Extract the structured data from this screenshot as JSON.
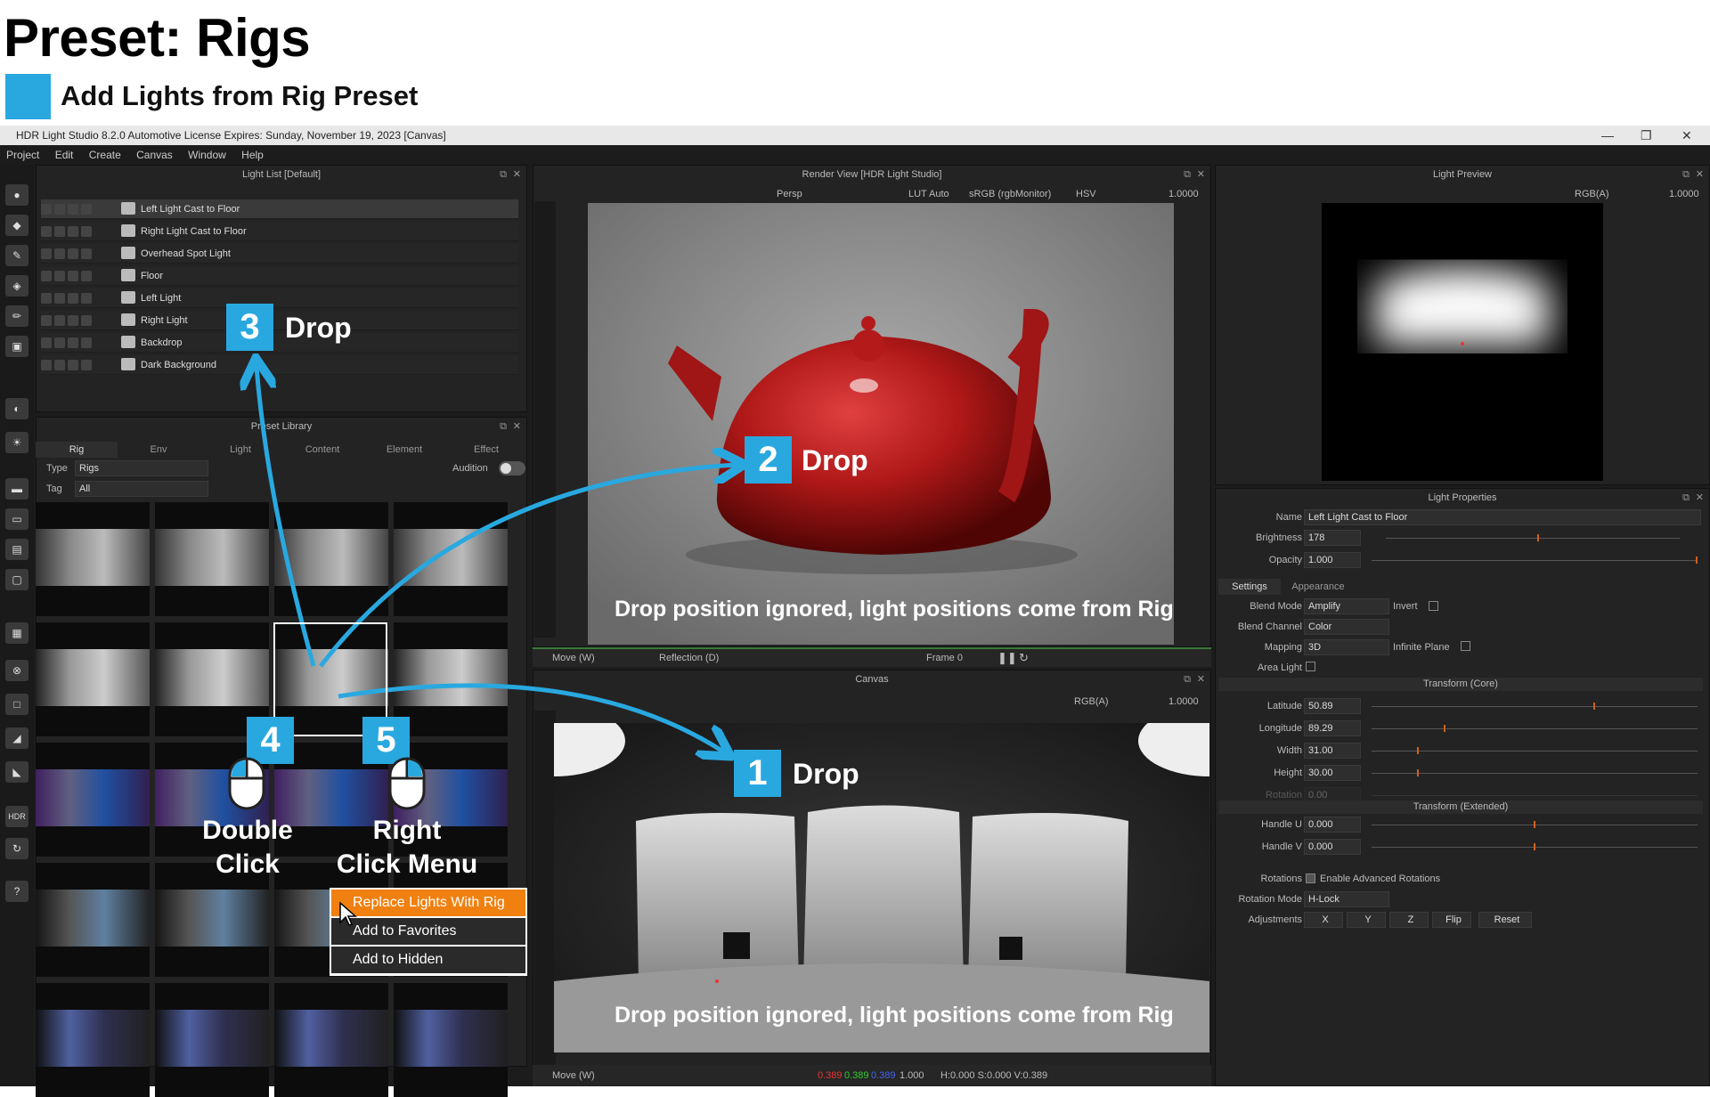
{
  "header": {
    "title": "Preset: Rigs",
    "legend": "Add Lights from Rig Preset",
    "legend_color": "#29a8e0"
  },
  "window": {
    "title": "HDR Light Studio 8.2.0  Automotive License Expires: Sunday, November 19, 2023  [Canvas]",
    "min": "—",
    "restore": "❐",
    "close": "✕"
  },
  "menu": [
    "Project",
    "Edit",
    "Create",
    "Canvas",
    "Window",
    "Help"
  ],
  "light_list": {
    "title": "Light List [Default]",
    "items": [
      "Left Light Cast to Floor",
      "Right Light Cast to Floor",
      "Overhead Spot Light",
      "Floor",
      "Left Light",
      "Right Light",
      "Backdrop",
      "Dark Background"
    ]
  },
  "preset_library": {
    "title": "Preset Library",
    "tabs": [
      "Rig",
      "Env",
      "Light",
      "Content",
      "Element",
      "Effect"
    ],
    "type_label": "Type",
    "type_value": "Rigs",
    "tag_label": "Tag",
    "tag_value": "All",
    "audition": "Audition"
  },
  "render_view": {
    "title": "Render View [HDR Light Studio]",
    "camera": "Persp",
    "lut": "LUT Auto",
    "color_space": "sRGB (rgbMonitor)",
    "mode": "HSV",
    "exposure": "1.0000",
    "move": "Move (W)",
    "reflection": "Reflection (D)",
    "frame": "Frame 0",
    "caption": "Drop position ignored, light positions come from Rig"
  },
  "canvas": {
    "title": "Canvas",
    "channel": "RGB(A)",
    "exposure": "1.0000",
    "caption": "Drop position ignored, light positions come from Rig",
    "move": "Move (W)",
    "r": "0.389",
    "g": "0.389",
    "b": "0.389",
    "a": "1.000",
    "hsv": "H:0.000 S:0.000 V:0.389"
  },
  "light_preview": {
    "title": "Light Preview",
    "channel": "RGB(A)",
    "exposure": "1.0000"
  },
  "light_properties": {
    "title": "Light Properties",
    "name_label": "Name",
    "name": "Left Light Cast to Floor",
    "brightness_label": "Brightness",
    "brightness": "178",
    "opacity_label": "Opacity",
    "opacity": "1.000",
    "tabs": [
      "Settings",
      "Appearance"
    ],
    "blend_mode_label": "Blend Mode",
    "blend_mode": "Amplify",
    "invert": "Invert",
    "blend_channel_label": "Blend Channel",
    "blend_channel": "Color",
    "mapping_label": "Mapping",
    "mapping": "3D",
    "infinite_plane": "Infinite Plane",
    "area_light": "Area Light",
    "transform_core": "Transform (Core)",
    "latitude_label": "Latitude",
    "latitude": "50.89",
    "longitude_label": "Longitude",
    "longitude": "89.29",
    "width_label": "Width",
    "width": "31.00",
    "height_label": "Height",
    "height": "30.00",
    "rotation_label": "Rotation",
    "rotation": "0.00",
    "transform_ext": "Transform (Extended)",
    "handle_u_label": "Handle U",
    "handle_u": "0.000",
    "handle_v_label": "Handle V",
    "handle_v": "0.000",
    "rotations_label": "Rotations",
    "enable_adv": "Enable Advanced Rotations",
    "rotation_mode_label": "Rotation Mode",
    "rotation_mode": "H-Lock",
    "adjustments_label": "Adjustments",
    "adj_x": "X",
    "adj_y": "Y",
    "adj_z": "Z",
    "flip": "Flip",
    "reset": "Reset"
  },
  "steps": {
    "s1": "1",
    "s1_label": "Drop",
    "s2": "2",
    "s2_label": "Drop",
    "s3": "3",
    "s3_label": "Drop",
    "s4": "4",
    "s4_label": "Double\nClick",
    "s5": "5",
    "s5_label": "Right\nClick Menu"
  },
  "context_menu": [
    "Replace Lights With Rig",
    "Add to Favorites",
    "Add to Hidden"
  ],
  "accent_arrow": "#29a8e0",
  "menu_highlight": "#f08010"
}
